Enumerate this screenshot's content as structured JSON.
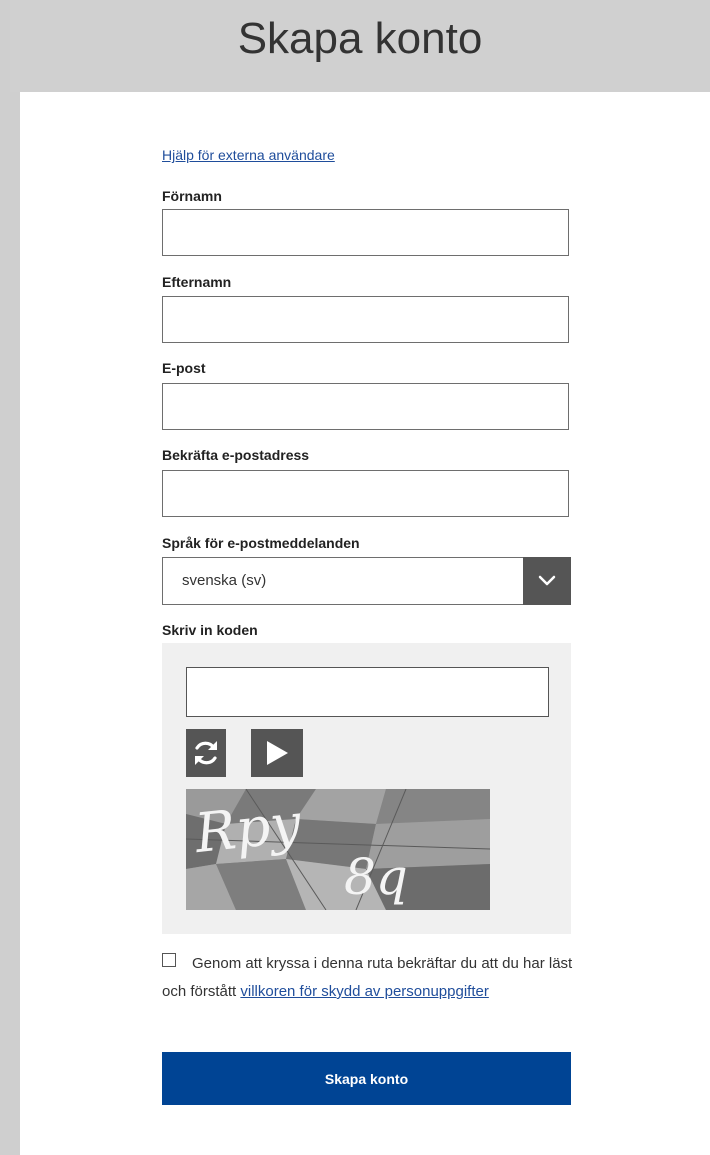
{
  "header": {
    "title": "Skapa konto"
  },
  "form": {
    "help_link": "Hjälp för externa användare",
    "first_name_label": "Förnamn",
    "first_name_value": "",
    "last_name_label": "Efternamn",
    "last_name_value": "",
    "email_label": "E-post",
    "email_value": "",
    "confirm_email_label": "Bekräfta e-postadress",
    "confirm_email_value": "",
    "language_label": "Språk för e-postmeddelanden",
    "language_value": "svenska (sv)",
    "captcha_label": "Skriv in koden",
    "captcha_value": "",
    "captcha_text": "Rpy8q",
    "consent_checked": false,
    "consent_text": "Genom att kryssa i denna ruta bekräftar du att du har läst och förstått",
    "consent_link": "villkoren för skydd av personuppgifter",
    "submit_label": "Skapa konto"
  },
  "icons": {
    "dropdown": "chevron-down-icon",
    "refresh": "refresh-icon",
    "play": "play-icon"
  },
  "colors": {
    "header_bg": "#d0d0d0",
    "link": "#1f4d9b",
    "primary_button": "#004494",
    "dark_control": "#555555",
    "captcha_panel": "#f0f0f0"
  }
}
